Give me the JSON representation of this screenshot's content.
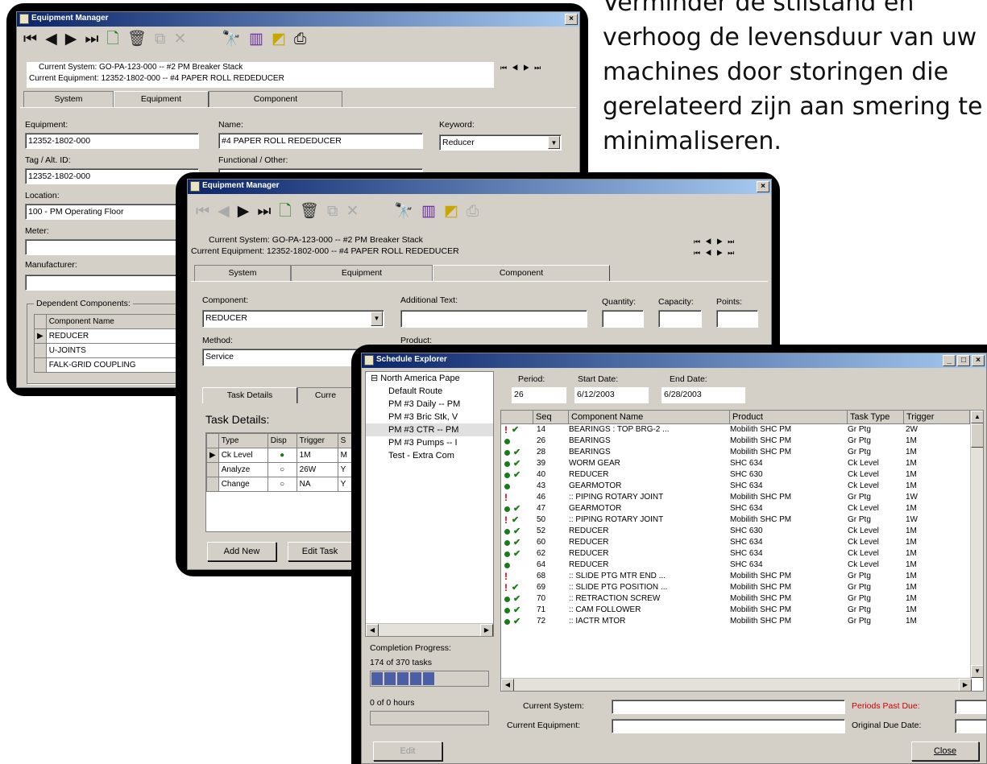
{
  "promo_text": "Verminder de stilstand en verhoog de levensduur van uw machines door storingen die gerelateerd zijn aan smering te minimaliseren.",
  "window1": {
    "title": "Equipment Manager",
    "current_system_label": "Current System:",
    "current_system_value": "GO-PA-123-000 -- #2 PM Breaker Stack",
    "current_equipment_label": "Current Equipment:",
    "current_equipment_value": "12352-1802-000 -- #4 PAPER ROLL REDEDUCER",
    "tabs": [
      "System",
      "Equipment",
      "Component"
    ],
    "equipment_label": "Equipment:",
    "equipment_value": "12352-1802-000",
    "name_label": "Name:",
    "name_value": "#4 PAPER ROLL REDEDUCER",
    "keyword_label": "Keyword:",
    "keyword_value": "Reducer",
    "tag_label": "Tag / Alt. ID:",
    "tag_value": "12352-1802-000",
    "functional_label": "Functional / Other:",
    "location_label": "Location:",
    "location_value": "100 - PM Operating Floor",
    "meter_label": "Meter:",
    "manufacturer_label": "Manufacturer:",
    "dependent_title": "Dependent Components:",
    "dependent_header": "Component Name",
    "dependent_rows": [
      "REDUCER",
      "U-JOINTS",
      "FALK-GRID COUPLING"
    ]
  },
  "window2": {
    "title": "Equipment Manager",
    "current_system_label": "Current System:",
    "current_system_value": "GO-PA-123-000 -- #2 PM Breaker Stack",
    "current_equipment_label": "Current Equipment:",
    "current_equipment_value": "12352-1802-000 -- #4 PAPER ROLL REDEDUCER",
    "tabs": [
      "System",
      "Equipment",
      "Component"
    ],
    "component_label": "Component:",
    "component_value": "REDUCER",
    "additional_label": "Additional Text:",
    "quantity_label": "Quantity:",
    "capacity_label": "Capacity:",
    "points_label": "Points:",
    "method_label": "Method:",
    "method_value": "Service",
    "product_label": "Product:",
    "subtabs": [
      "Task Details",
      "Curre"
    ],
    "task_details_title": "Task Details:",
    "task_headers": [
      "Type",
      "Disp",
      "Trigger",
      "S"
    ],
    "task_rows": [
      {
        "type": "Ck Level",
        "disp": "●",
        "trigger": "1M",
        "s": "M"
      },
      {
        "type": "Analyze",
        "disp": "○",
        "trigger": "26W",
        "s": "Y"
      },
      {
        "type": "Change",
        "disp": "○",
        "trigger": "NA",
        "s": "Y"
      }
    ],
    "add_new": "Add New",
    "edit_task": "Edit Task"
  },
  "window3": {
    "title": "Schedule Explorer",
    "tree_root": "North America Pape",
    "tree_items": [
      "Default Route",
      "PM #3 Daily -- PM",
      "PM #3 Bric Stk, V",
      "PM #3 CTR -- PM",
      "PM #3 Pumps -- I",
      "Test - Extra Com"
    ],
    "period_label": "Period:",
    "period_value": "26",
    "start_label": "Start Date:",
    "start_value": "6/12/2003",
    "end_label": "End Date:",
    "end_value": "6/28/2003",
    "columns": [
      "Seq",
      "Component Name",
      "Product",
      "Task Type",
      "Trigger"
    ],
    "rows": [
      {
        "flag": "!",
        "ok": "✔",
        "seq": "14",
        "name": "BEARINGS : TOP BRG-2 ...",
        "product": "Mobilith SHC PM",
        "type": "Gr Ptg",
        "trigger": "2W"
      },
      {
        "flag": "●",
        "ok": "",
        "seq": "26",
        "name": "BEARINGS",
        "product": "Mobilith SHC PM",
        "type": "Gr Ptg",
        "trigger": "1M"
      },
      {
        "flag": "●",
        "ok": "✔",
        "seq": "28",
        "name": "BEARINGS",
        "product": "Mobilith SHC PM",
        "type": "Gr Ptg",
        "trigger": "1M"
      },
      {
        "flag": "●",
        "ok": "✔",
        "seq": "39",
        "name": "WORM GEAR",
        "product": "SHC 634",
        "type": "Ck Level",
        "trigger": "1M"
      },
      {
        "flag": "●",
        "ok": "✔",
        "seq": "40",
        "name": "REDUCER",
        "product": "SHC 630",
        "type": "Ck Level",
        "trigger": "1M"
      },
      {
        "flag": "●",
        "ok": "",
        "seq": "43",
        "name": "GEARMOTOR",
        "product": "SHC 634",
        "type": "Ck Level",
        "trigger": "1M"
      },
      {
        "flag": "!",
        "ok": "",
        "seq": "46",
        "name": ":: PIPING ROTARY JOINT",
        "product": "Mobilith SHC PM",
        "type": "Gr Ptg",
        "trigger": "1W"
      },
      {
        "flag": "●",
        "ok": "✔",
        "seq": "47",
        "name": "GEARMOTOR",
        "product": "SHC 634",
        "type": "Ck Level",
        "trigger": "1M"
      },
      {
        "flag": "!",
        "ok": "✔",
        "seq": "50",
        "name": ":: PIPING ROTARY JOINT",
        "product": "Mobilith SHC PM",
        "type": "Gr Ptg",
        "trigger": "1W"
      },
      {
        "flag": "●",
        "ok": "✔",
        "seq": "52",
        "name": "REDUCER",
        "product": "SHC 630",
        "type": "Ck Level",
        "trigger": "1M"
      },
      {
        "flag": "●",
        "ok": "✔",
        "seq": "60",
        "name": "REDUCER",
        "product": "SHC 634",
        "type": "Ck Level",
        "trigger": "1M"
      },
      {
        "flag": "●",
        "ok": "✔",
        "seq": "62",
        "name": "REDUCER",
        "product": "SHC 634",
        "type": "Ck Level",
        "trigger": "1M"
      },
      {
        "flag": "●",
        "ok": "",
        "seq": "64",
        "name": "REDUCER",
        "product": "SHC 634",
        "type": "Ck Level",
        "trigger": "1M"
      },
      {
        "flag": "!",
        "ok": "",
        "seq": "68",
        "name": ":: SLIDE PTG MTR END ...",
        "product": "Mobilith SHC PM",
        "type": "Gr Ptg",
        "trigger": "1M"
      },
      {
        "flag": "!",
        "ok": "✔",
        "seq": "69",
        "name": ":: SLIDE PTG POSITION ...",
        "product": "Mobilith SHC PM",
        "type": "Gr Ptg",
        "trigger": "1M"
      },
      {
        "flag": "●",
        "ok": "✔",
        "seq": "70",
        "name": ":: RETRACTION SCREW",
        "product": "Mobilith SHC PM",
        "type": "Gr Ptg",
        "trigger": "1M"
      },
      {
        "flag": "●",
        "ok": "✔",
        "seq": "71",
        "name": ":: CAM FOLLOWER",
        "product": "Mobilith SHC PM",
        "type": "Gr Ptg",
        "trigger": "1M"
      },
      {
        "flag": "●",
        "ok": "✔",
        "seq": "72",
        "name": ":: IACTR MTOR",
        "product": "Mobilith SHC PM",
        "type": "Gr Ptg",
        "trigger": "1M"
      }
    ],
    "completion_label": "Completion Progress:",
    "completion_value": "174 of 370 tasks",
    "completion_fraction": 0.47,
    "hours_label": "0 of 0 hours",
    "current_system_label": "Current System:",
    "current_equipment_label": "Current Equipment:",
    "periods_past_due_label": "Periods Past Due:",
    "original_due_label": "Original Due Date:",
    "edit_button": "Edit",
    "close_button": "Close",
    "colors": {
      "past_due": "#cc0000",
      "progress": "#4a5fa6"
    }
  }
}
